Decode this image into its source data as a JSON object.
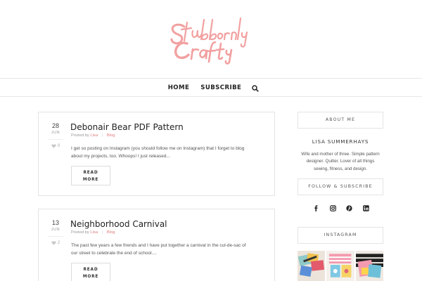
{
  "site": {
    "logo_text": "Stubbornly Crafty",
    "logo_color": "#f2a0a0"
  },
  "nav": {
    "items": [
      {
        "label": "HOME"
      },
      {
        "label": "SUBSCRIBE"
      }
    ],
    "search_icon": "search-icon"
  },
  "posts": [
    {
      "day": "28",
      "month": "JUN",
      "likes": "0",
      "title": "Debonair Bear PDF Pattern",
      "posted_by": "Posted by",
      "author": "Lisa",
      "category": "Blog",
      "excerpt": "I get so posting on Instagram (you should follow me on Instagram) that I forget to blog about my projects, too. Whoops! I just released...",
      "read_more_1": "READ",
      "read_more_2": "MORE"
    },
    {
      "day": "13",
      "month": "JUN",
      "likes": "2",
      "title": "Neighborhood Carnival",
      "posted_by": "Posted by",
      "author": "Lisa",
      "category": "Blog",
      "excerpt": "The past few years a few friends and I have put together a carnival in the cul-de-sac of our street to celebrate the end of school....",
      "read_more_1": "READ",
      "read_more_2": "MORE"
    }
  ],
  "sidebar": {
    "about_title": "ABOUT ME",
    "author_name": "LISA SUMMERHAYS",
    "author_bio": "Wife and mother of three. Simple pattern designer. Quilter. Lover of all things sewing, fitness, and design.",
    "follow_title": "FOLLOW & SUBSCRIBE",
    "social_icons": [
      "facebook-icon",
      "instagram-icon",
      "pinterest-icon",
      "linkedin-icon"
    ],
    "instagram_title": "INSTAGRAM"
  },
  "colors": {
    "accent": "#e07a7a",
    "border": "#e4e4e4"
  }
}
